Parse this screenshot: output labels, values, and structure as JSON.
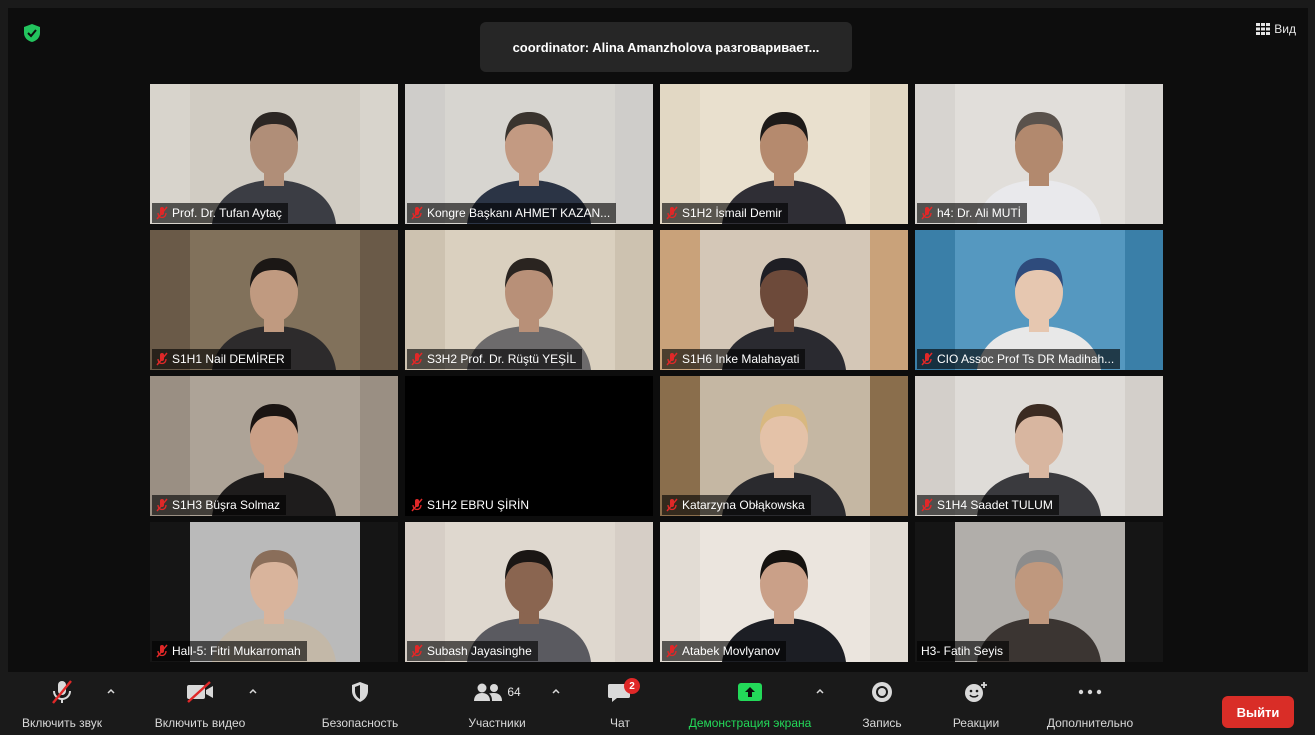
{
  "banner": {
    "speaking_text": "coordinator: Alina Amanzholova разговаривает..."
  },
  "view_label": "Вид",
  "participants": [
    {
      "name": "Prof. Dr. Tufan Aytaç",
      "bg": "#d8d4cc",
      "wall": "#cfcac0",
      "skin": "#b08e78",
      "shirt": "#3b3d44",
      "hair": "#2c2623"
    },
    {
      "name": "Kongre Başkanı AHMET KAZAN...",
      "bg": "#cfcdca",
      "wall": "#d9d7d2",
      "skin": "#c39a82",
      "shirt": "#2b3445",
      "hair": "#3a342e"
    },
    {
      "name": "S1H2 İsmail Demir",
      "bg": "#e2d8c4",
      "wall": "#ebe3d2",
      "skin": "#b58a6e",
      "shirt": "#2f2e35",
      "hair": "#1d1a18"
    },
    {
      "name": "h4: Dr. Ali MUTİ",
      "bg": "#d7d4d0",
      "wall": "#e4e2de",
      "skin": "#b2896e",
      "shirt": "#e9e9ec",
      "hair": "#5a524c"
    },
    {
      "name": "S1H1 Nail DEMİRER",
      "bg": "#6a5a48",
      "wall": "#8a7a62",
      "skin": "#c09a80",
      "shirt": "#2d2b2c",
      "hair": "#1b1715"
    },
    {
      "name": "S3H2 Prof. Dr. Rüştü YEŞİL",
      "bg": "#cdc2b0",
      "wall": "#ddd4c4",
      "skin": "#b89078",
      "shirt": "#6d6b6c",
      "hair": "#2a2420"
    },
    {
      "name": "S1H6 Inke Malahayati",
      "bg": "#c9a27a",
      "wall": "#d7d3cc",
      "skin": "#6d4a3a",
      "shirt": "#2a2a30",
      "hair": "#1e1e24"
    },
    {
      "name": "CIO Assoc Prof Ts DR Madihah...",
      "bg": "#3a7fa8",
      "wall": "#5fa0c8",
      "skin": "#e6c7b0",
      "shirt": "#e8e8e8",
      "hair": "#2e4b7c"
    },
    {
      "name": "S1H3 Büşra Solmaz",
      "bg": "#9a8f83",
      "wall": "#b3a99d",
      "skin": "#caa087",
      "shirt": "#1e1c1c",
      "hair": "#1a1412"
    },
    {
      "name": "S1H2 EBRU ŞİRİN",
      "bg": "#000000",
      "wall": "#000000",
      "skin": "",
      "shirt": "",
      "hair": ""
    },
    {
      "name": "Katarzyna Obłąkowska",
      "bg": "#8a6e4c",
      "wall": "#d8d0c0",
      "skin": "#e4c2a8",
      "shirt": "#2a2a2e",
      "hair": "#d8b880"
    },
    {
      "name": "S1H4 Saadet TULUM",
      "bg": "#d3cfca",
      "wall": "#e3e0dc",
      "skin": "#d8b6a0",
      "shirt": "#3a3a3e",
      "hair": "#3b2b22"
    },
    {
      "name": "Hall-5: Fitri Mukarromah",
      "bg": "#151515",
      "wall": "#f2f2f2",
      "skin": "#d9b49c",
      "shirt": "#c3b8a8",
      "hair": "#8a6e5a"
    },
    {
      "name": "Subash Jayasinghe",
      "bg": "#d6cec6",
      "wall": "#e2dbd2",
      "skin": "#8a6550",
      "shirt": "#5a5a60",
      "hair": "#1a1614"
    },
    {
      "name": "Atabek Movlyanov",
      "bg": "#e2dcd4",
      "wall": "#ede8e2",
      "skin": "#caa088",
      "shirt": "#1c1e24",
      "hair": "#15120f"
    },
    {
      "name": "H3- Fatih Seyis",
      "bg": "#151515",
      "wall": "#e6e2dc",
      "skin": "#bf987e",
      "shirt": "#3b3532",
      "hair": "#8c8c8c"
    }
  ],
  "name_tag_muted": [
    true,
    true,
    true,
    true,
    true,
    true,
    true,
    true,
    true,
    true,
    true,
    true,
    true,
    true,
    true,
    false
  ],
  "toolbar": {
    "unmute_label": "Включить звук",
    "video_label": "Включить видео",
    "security_label": "Безопасность",
    "participants_label": "Участники",
    "participants_count": "64",
    "chat_label": "Чат",
    "chat_badge": "2",
    "share_label": "Демонстрация экрана",
    "record_label": "Запись",
    "reactions_label": "Реакции",
    "more_label": "Дополнительно",
    "leave_label": "Выйти"
  },
  "colors": {
    "accent_green": "#23d959",
    "leave_red": "#d92d27",
    "muted_red": "#e02828"
  }
}
